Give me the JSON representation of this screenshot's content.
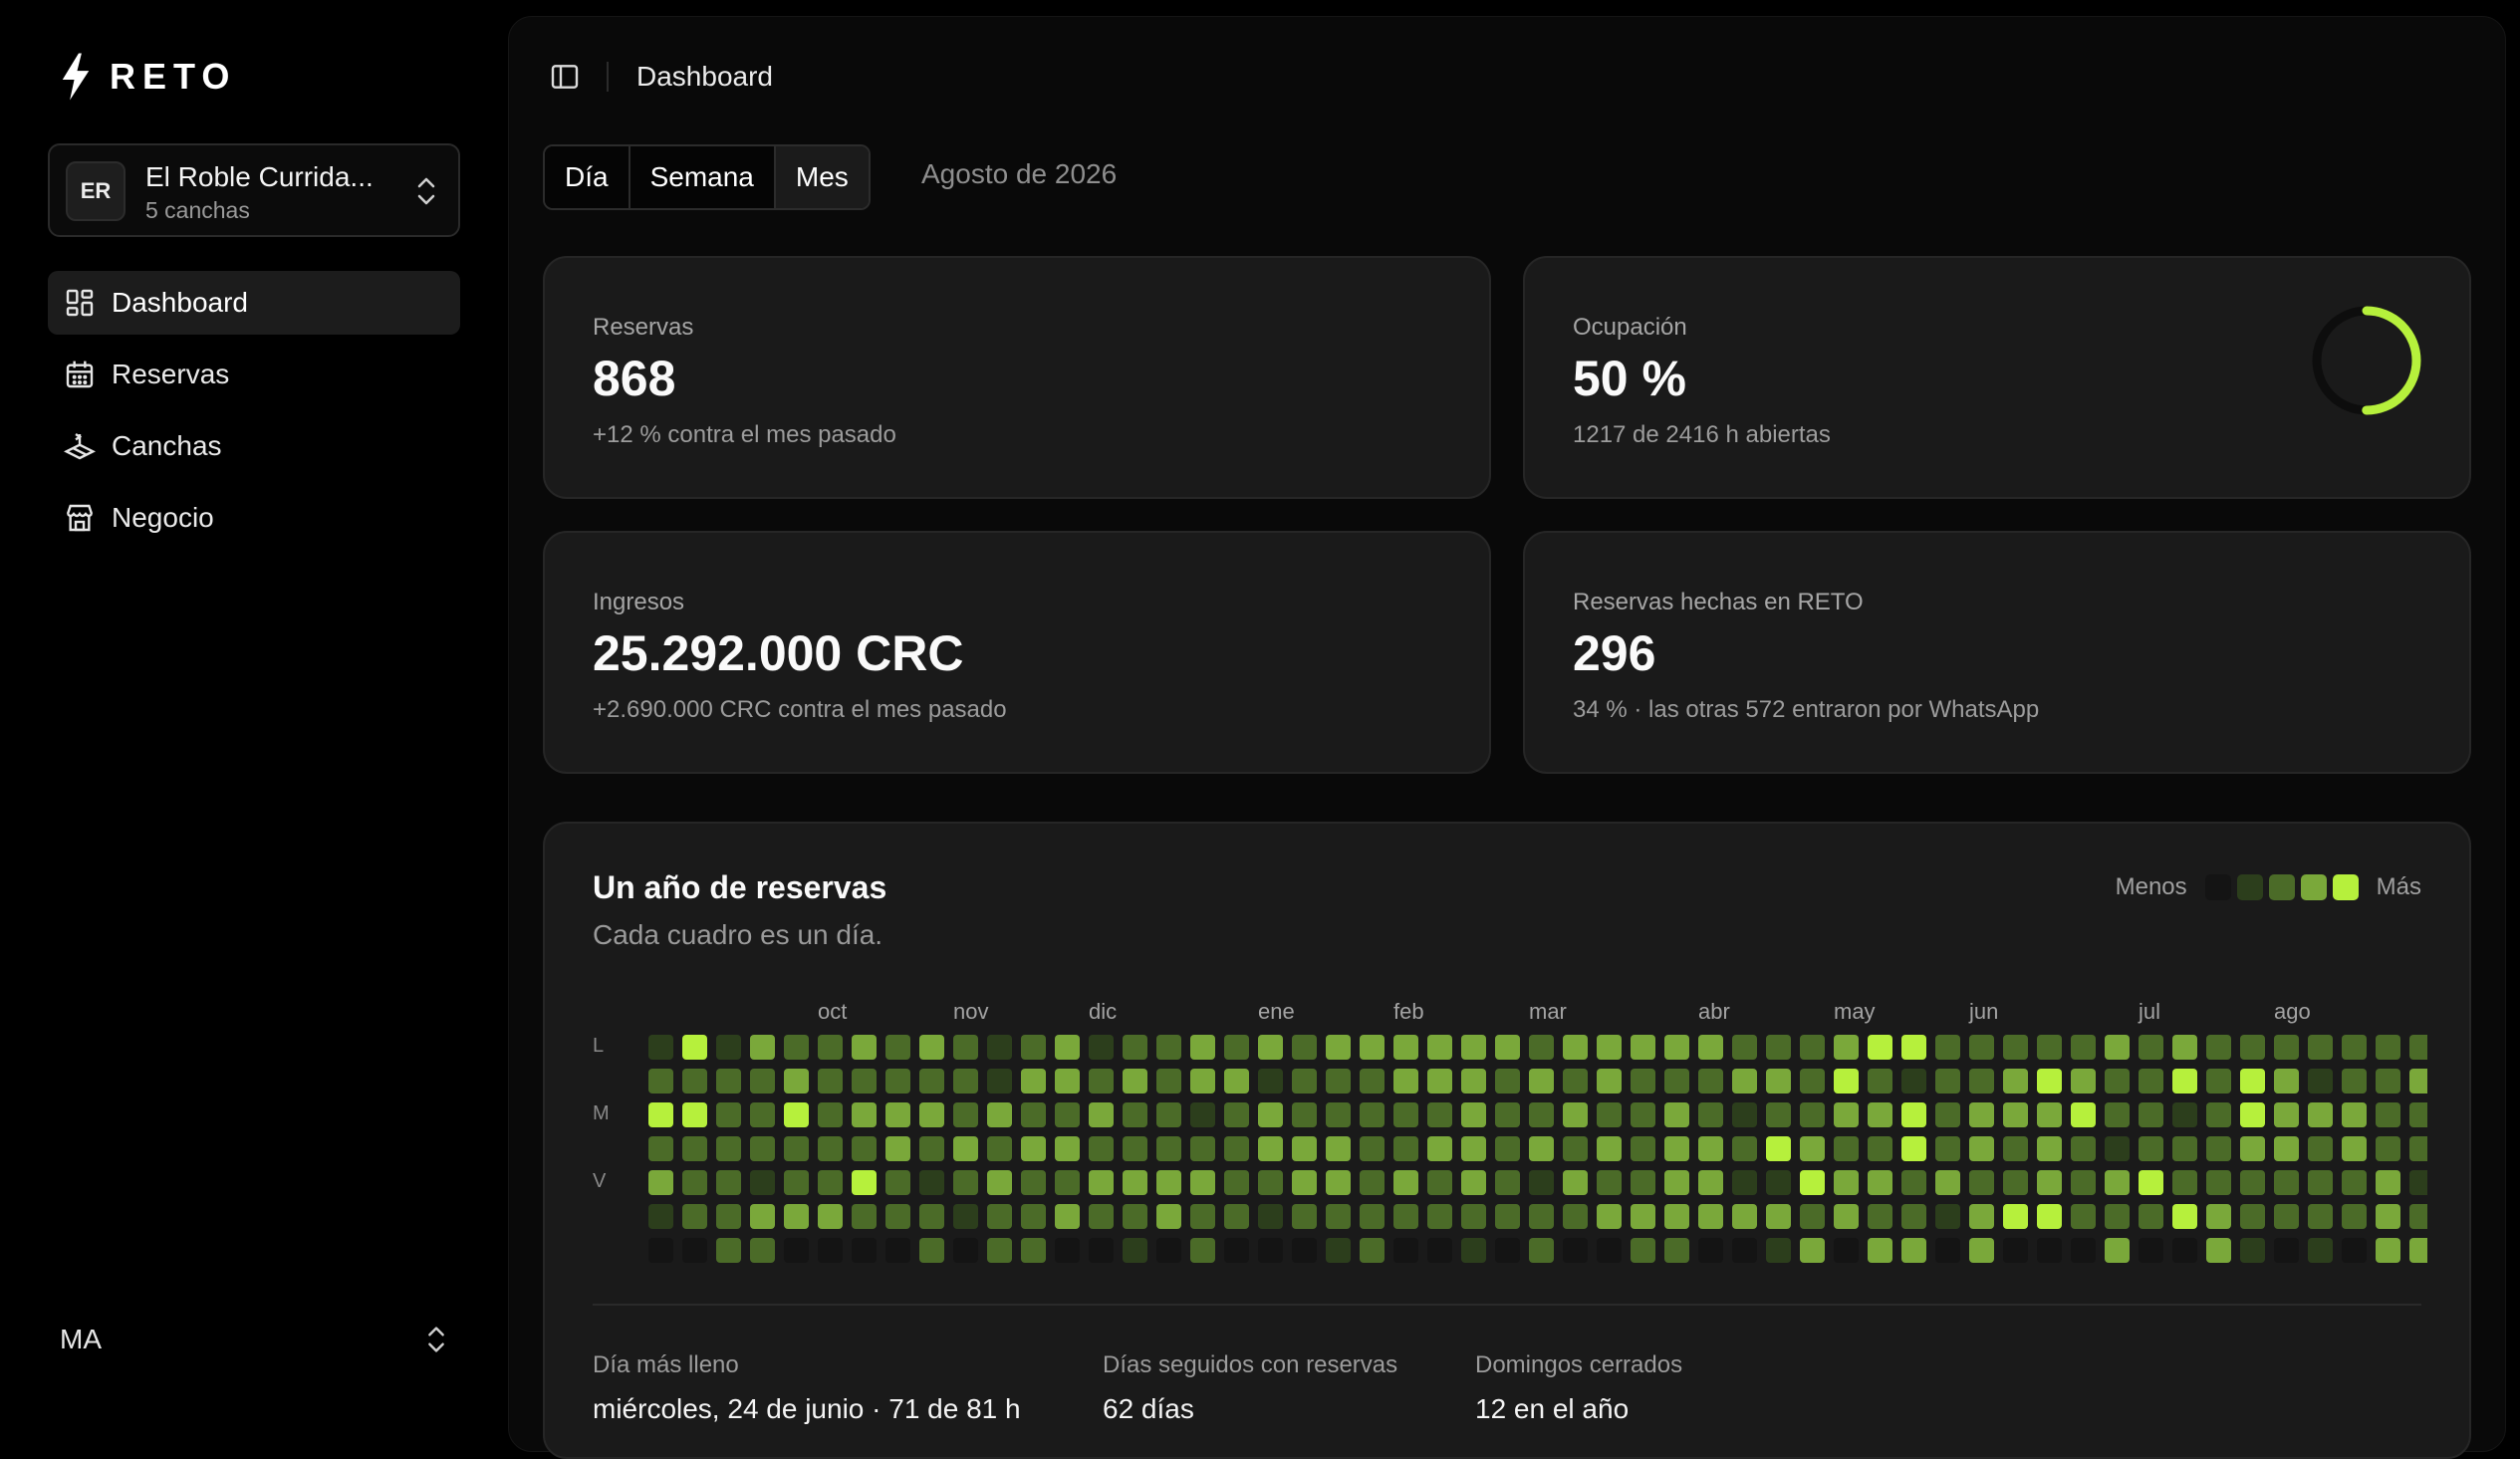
{
  "app": {
    "name": "RETO"
  },
  "org": {
    "initials": "ER",
    "name": "El Roble Currida...",
    "sub": "5 canchas"
  },
  "nav": [
    {
      "label": "Dashboard",
      "icon": "dashboard-grid-icon",
      "active": true
    },
    {
      "label": "Reservas",
      "icon": "calendar-icon"
    },
    {
      "label": "Canchas",
      "icon": "court-icon"
    },
    {
      "label": "Negocio",
      "icon": "store-icon"
    }
  ],
  "user": {
    "initials": "MA"
  },
  "header": {
    "breadcrumb": "Dashboard"
  },
  "period_tabs": [
    "Día",
    "Semana",
    "Mes"
  ],
  "period_active": "Mes",
  "period_label": "Agosto de 2026",
  "cards": {
    "reservas": {
      "label": "Reservas",
      "value": "868",
      "sub": "+12 % contra el mes pasado"
    },
    "ocupacion": {
      "label": "Ocupación",
      "value": "50 %",
      "sub": "1217 de 2416 h abiertas",
      "ring_fraction": 0.5
    },
    "ingresos": {
      "label": "Ingresos",
      "value": "25.292.000 CRC",
      "sub": "+2.690.000 CRC contra el mes pasado"
    },
    "reto": {
      "label": "Reservas hechas en RETO",
      "value": "296",
      "sub": "34 % · las otras 572 entraron por WhatsApp"
    }
  },
  "heatmap": {
    "title": "Un año de reservas",
    "subtitle": "Cada cuadro es un día.",
    "legend_less": "Menos",
    "legend_more": "Más",
    "months": [
      "oct",
      "nov",
      "dic",
      "ene",
      "feb",
      "mar",
      "abr",
      "may",
      "jun",
      "jul",
      "ago"
    ],
    "weekdays": [
      "L",
      "M",
      "V"
    ],
    "colors": [
      "#141414",
      "#2c3e1c",
      "#4b6b28",
      "#7aa83a",
      "#b6f03c"
    ]
  },
  "stats": [
    {
      "label": "Día más lleno",
      "value": "miércoles, 24 de junio · 71 de 81 h"
    },
    {
      "label": "Días seguidos con reservas",
      "value": "62 días"
    },
    {
      "label": "Domingos cerrados",
      "value": "12 en el año"
    }
  ],
  "colors": {
    "accent": "#b6f03c",
    "background": "#000000",
    "card": "#1a1a1a"
  }
}
